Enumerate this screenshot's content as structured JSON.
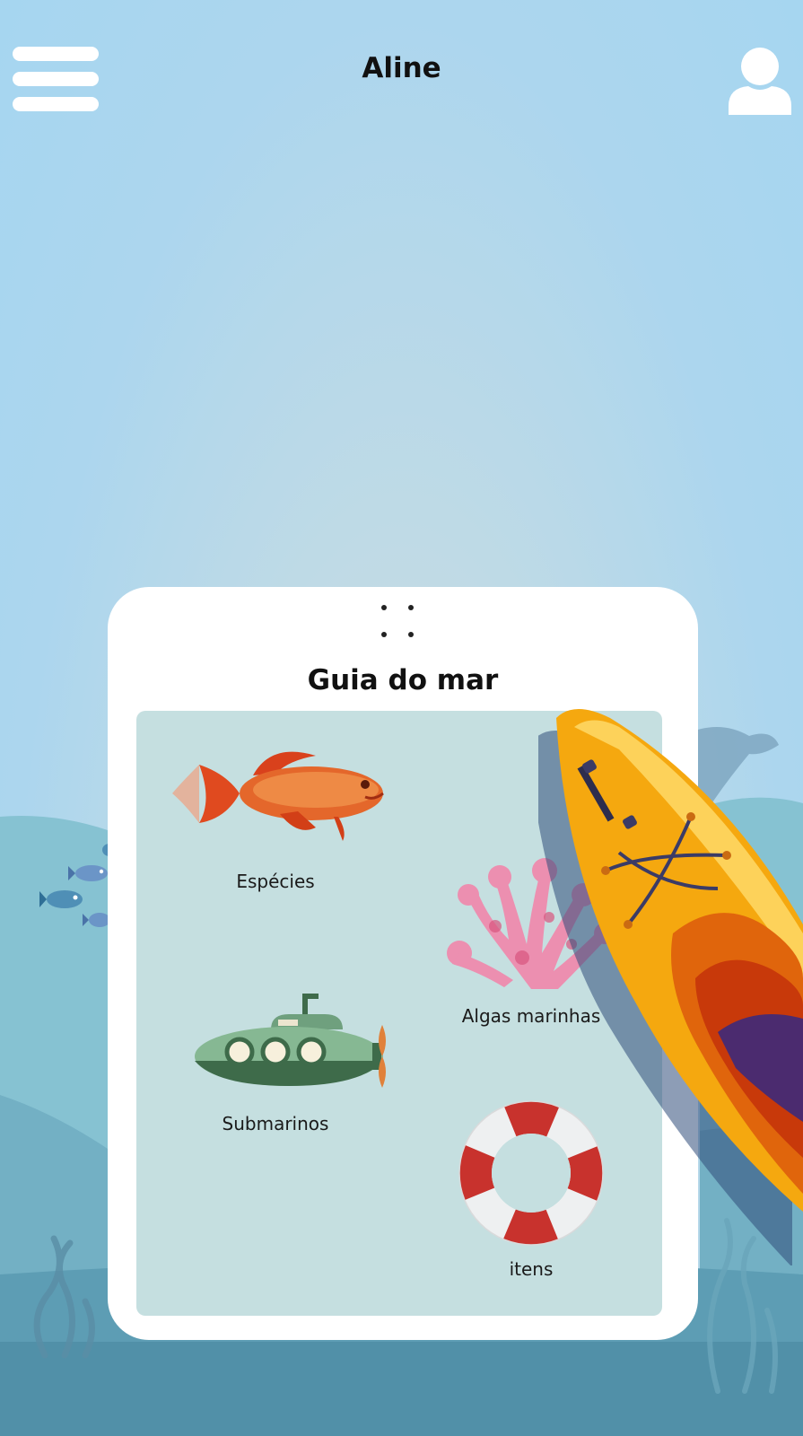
{
  "header": {
    "title": "Aline",
    "menu_icon": "hamburger-menu-icon",
    "profile_icon": "user-profile-icon"
  },
  "guide": {
    "title": "Guia do mar",
    "handle_icon": "drag-handle-icon",
    "categories": [
      {
        "label": "Espécies",
        "icon": "goldfish-icon"
      },
      {
        "label": "Algas marinhas",
        "icon": "coral-icon"
      },
      {
        "label": "Submarinos",
        "icon": "submarine-icon"
      },
      {
        "label": "itens",
        "icon": "lifebuoy-icon"
      }
    ]
  },
  "decorations": [
    "wave-hills",
    "small-fish-school",
    "whale-silhouette",
    "seaweed",
    "kayak-illustration"
  ],
  "colors": {
    "sky": "#a6d6f0",
    "sea_light": "#86c2d2",
    "sea_deep": "#5190a8",
    "card_bg": "#ffffff",
    "panel_bg": "#c5dfe0",
    "kayak": "#f5a80f",
    "lifebuoy_red": "#c8322d"
  }
}
